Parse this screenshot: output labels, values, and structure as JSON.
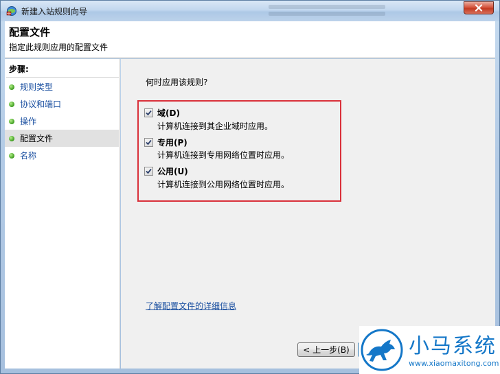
{
  "window": {
    "title": "新建入站规则向导",
    "close_icon": "close-icon"
  },
  "header": {
    "title": "配置文件",
    "subtitle": "指定此规则应用的配置文件"
  },
  "sidebar": {
    "steps_label": "步骤:",
    "items": [
      {
        "label": "规则类型",
        "current": false
      },
      {
        "label": "协议和端口",
        "current": false
      },
      {
        "label": "操作",
        "current": false
      },
      {
        "label": "配置文件",
        "current": true
      },
      {
        "label": "名称",
        "current": false
      }
    ]
  },
  "main": {
    "question": "何时应用该规则?",
    "options": [
      {
        "label": "域(D)",
        "description": "计算机连接到其企业域时应用。",
        "checked": true
      },
      {
        "label": "专用(P)",
        "description": "计算机连接到专用网络位置时应用。",
        "checked": true
      },
      {
        "label": "公用(U)",
        "description": "计算机连接到公用网络位置时应用。",
        "checked": true
      }
    ],
    "info_link": "了解配置文件的详细信息"
  },
  "footer": {
    "back_button": "< 上一步(B)"
  },
  "watermark": {
    "title": "小马系统",
    "url": "www.xiaomaxitong.com"
  },
  "colors": {
    "highlight": "#d9303a",
    "link": "#1a4fa0",
    "brand": "#1477c8"
  }
}
